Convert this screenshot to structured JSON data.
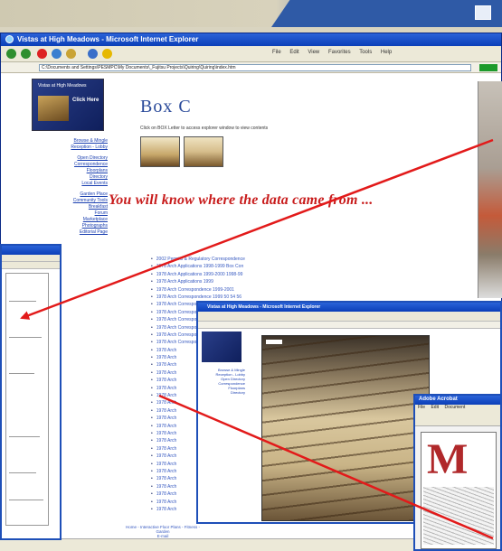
{
  "window": {
    "title": "Vistas at High Meadows - Microsoft Internet Explorer",
    "address": "C:\\Documents and Settings\\PESMPC\\My Documents\\_Fujitsu Projects\\Quiring\\Quiring\\index.htm",
    "menu": [
      "File",
      "Edit",
      "View",
      "Favorites",
      "Tools",
      "Help"
    ]
  },
  "nav": {
    "banner_title": "Vistas at High Meadows",
    "banner_click": "Click Here",
    "links": [
      "Browse & Mingle",
      "Reception - Lobby",
      "",
      "Open Directory",
      "Correspondence",
      "Floorplans",
      "Directory",
      "Local Events",
      "",
      "Garden Place",
      "Community Tools",
      "Breakfast",
      "Forum",
      "Marketplace",
      "Photographs",
      "Editorial Page"
    ]
  },
  "main": {
    "title": "Box C",
    "instruction": "Click on BOX Letter to access explorer window to view contents",
    "headline": "You will know where the data came from ..."
  },
  "file_list": [
    "2002 Permits & Regulatory Correspondence",
    "1978 Arch Applications 1998-1999 Box Con",
    "1978 Arch Applications 1999-2000 1998-99",
    "1978 Arch Applications 1999",
    "1978 Arch Correspondence 1999-2001",
    "1978 Arch Correspondence 1999 50 54 56",
    "1978 Arch Correspondence 1998",
    "1978 Arch Correspondence 1997-98",
    "1978 Arch Correspondence 1996-97",
    "1978 Arch Correspondence",
    "1978 Arch Correspondence 1995-97",
    "1978 Arch Correspondence 1995",
    "1978 Arch",
    "1978 Arch",
    "1978 Arch",
    "1978 Arch",
    "1978 Arch",
    "1978 Arch",
    "1978 Arch",
    "1978 Arch",
    "1978 Arch",
    "1978 Arch",
    "1978 Arch",
    "1978 Arch",
    "1978 Arch",
    "1978 Arch",
    "1978 Arch",
    "1978 Arch",
    "1978 Arch",
    "1978 Arch",
    "1978 Arch",
    "1978 Arch",
    "1978 Arch",
    "1978 Arch"
  ],
  "footer": {
    "links": "Home - Interactive Floor Plans - Fitness - Garden",
    "sub": "E-mail"
  },
  "mid_window": {
    "title": "Vistas at High Meadows - Microsoft Internet Explorer"
  },
  "acrobat": {
    "title": "Adobe Acrobat",
    "menu": [
      "File",
      "Edit",
      "Document"
    ],
    "letter": "M"
  },
  "colors": {
    "headline": "#c81c1c",
    "title_bar": "#0b3fb8",
    "link": "#3558c0",
    "arrow": "#e21a1a"
  }
}
